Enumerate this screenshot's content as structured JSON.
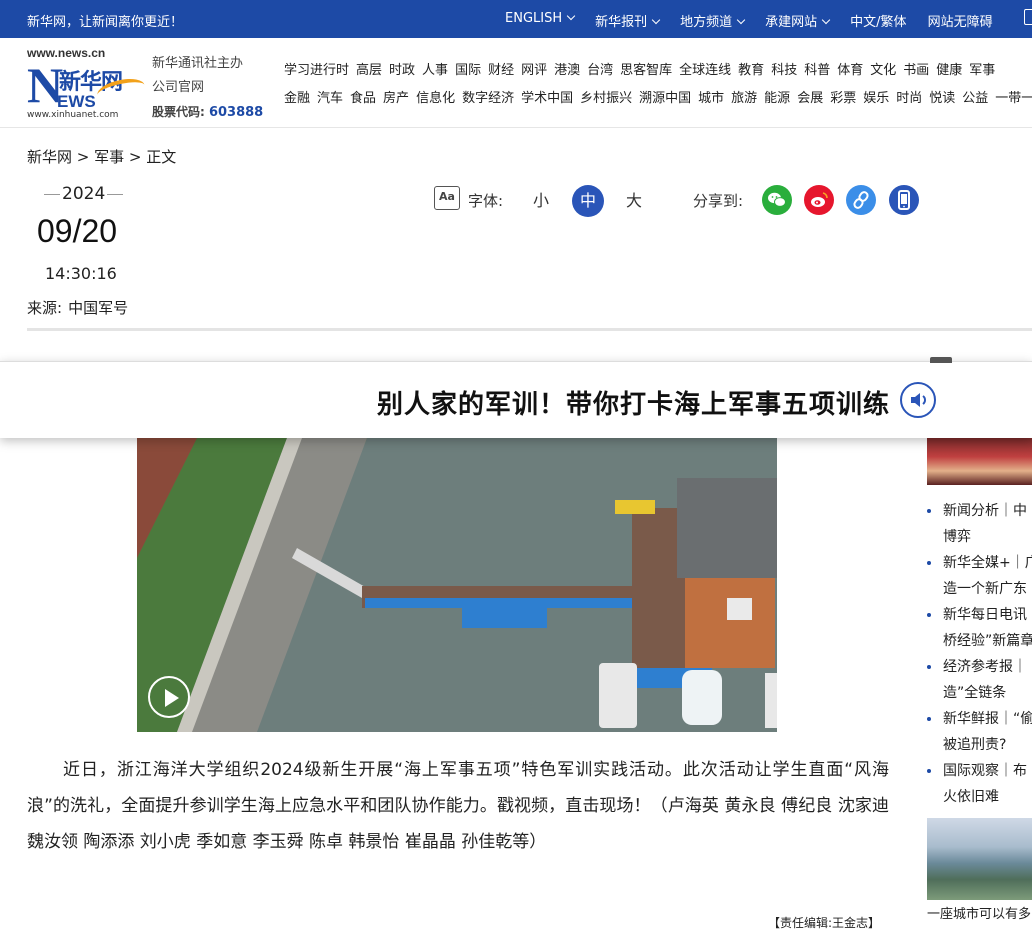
{
  "topbar": {
    "slogan": "新华网，让新闻离你更近！",
    "links": [
      {
        "label": "ENGLISH",
        "dropdown": true
      },
      {
        "label": "新华报刊",
        "dropdown": true
      },
      {
        "label": "地方频道",
        "dropdown": true
      },
      {
        "label": "承建网站",
        "dropdown": true
      },
      {
        "label": "中文/繁体",
        "dropdown": false
      },
      {
        "label": "网站无障碍",
        "dropdown": false
      }
    ]
  },
  "header": {
    "logo": {
      "url_top": "www.news.cn",
      "brand": "新华网",
      "letter": "N",
      "ews": "EWS",
      "url_bottom": "www.xinhuanet.com"
    },
    "org_line1": "新华通讯社主办",
    "org_line2": "公司官网",
    "stock_label": "股票代码:",
    "stock_code": "603888",
    "nav_row1": [
      "学习进行时",
      "高层",
      "时政",
      "人事",
      "国际",
      "财经",
      "网评",
      "港澳",
      "台湾",
      "思客智库",
      "全球连线",
      "教育",
      "科技",
      "科普",
      "体育",
      "文化",
      "书画",
      "健康",
      "军事"
    ],
    "nav_row2": [
      "金融",
      "汽车",
      "食品",
      "房产",
      "信息化",
      "数字经济",
      "学术中国",
      "乡村振兴",
      "溯源中国",
      "城市",
      "旅游",
      "能源",
      "会展",
      "彩票",
      "娱乐",
      "时尚",
      "悦读",
      "公益",
      "一带一"
    ]
  },
  "breadcrumb": {
    "home": "新华网",
    "sep1": " > ",
    "section": "军事",
    "sep2": " > ",
    "current": "正文"
  },
  "meta": {
    "year": "2024",
    "month_day": "09/20",
    "time": "14:30:16",
    "source_label": "来源:",
    "source": "中国军号"
  },
  "tools": {
    "aa": "Aa",
    "font_label": "字体:",
    "font_sizes": [
      "小",
      "中",
      "大"
    ],
    "active_font": "中",
    "share_label": "分享到:",
    "share_icons": [
      "wechat-icon",
      "weibo-icon",
      "link-icon",
      "mobile-icon"
    ]
  },
  "article": {
    "title": "别人家的军训！带你打卡海上军事五项训练",
    "body": "近日，浙江海洋大学组织2024级新生开展“海上军事五项”特色军训实践活动。此次活动让学生直面“风海浪”的洗礼，全面提升参训学生海上应急水平和团队协作能力。戳视频，直击现场！（卢海英 黄永良 傅纪良 沈家迪 魏汝领 陶添添 刘小虎 季如意 李玉舜 陈卓 韩景怡 崔晶晶 孙佳乾等）",
    "editor": "【责任编辑:王金志】"
  },
  "sidebar": {
    "items": [
      {
        "line1": "新闻分析｜中",
        "line2": "博弈"
      },
      {
        "line1": "新华全媒+｜广",
        "line2": "造一个新广东"
      },
      {
        "line1": "新华每日电讯",
        "line2": "桥经验”新篇章"
      },
      {
        "line1": "经济参考报｜",
        "line2": "造”全链条"
      },
      {
        "line1": "新华鲜报｜“偷",
        "line2": "被追刑责?"
      },
      {
        "line1": "国际观察｜布",
        "line2": "火依旧难"
      }
    ],
    "thumb2_caption": "一座城市可以有多"
  },
  "colors": {
    "brand_blue": "#1d4aa6",
    "active_font": "#2a55b8",
    "wechat": "#2aae3c",
    "weibo": "#e6162d",
    "link": "#3b8ee8",
    "mobile": "#2a55b8"
  }
}
